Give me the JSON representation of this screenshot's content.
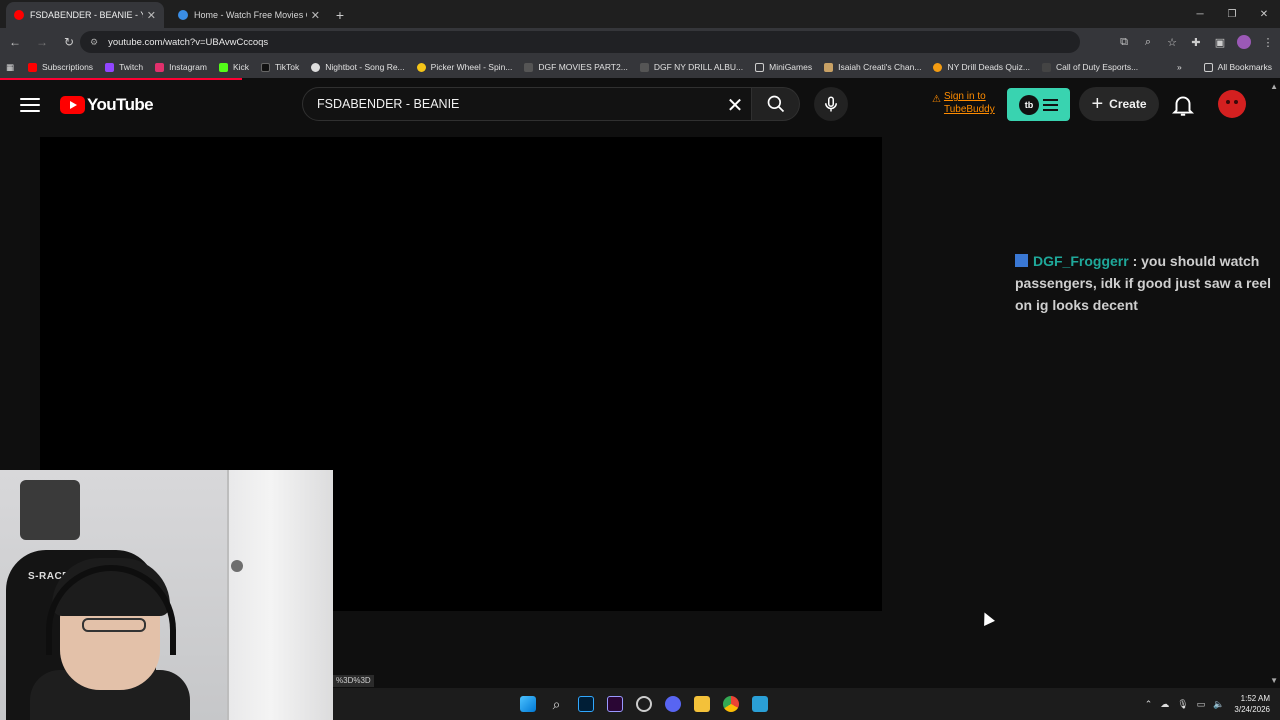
{
  "browser": {
    "tabs": [
      {
        "title": "FSDABENDER - BEANIE - YouTu",
        "active": true,
        "favicon_color": "#ff0000"
      },
      {
        "title": "Home - Watch Free Movies On",
        "active": false,
        "favicon_color": "#3a8ee6"
      }
    ],
    "url": "youtube.com/watch?v=UBAvwCccoqs",
    "bookmarks": [
      {
        "label": "Subscriptions",
        "icon_color": "#ff0000"
      },
      {
        "label": "Twitch",
        "icon_color": "#9146ff"
      },
      {
        "label": "Instagram",
        "icon_color": "#e1306c"
      },
      {
        "label": "Kick",
        "icon_color": "#53fc18"
      },
      {
        "label": "TikTok",
        "icon_color": "#111111"
      },
      {
        "label": "Nightbot - Song Re...",
        "icon_color": "#dddddd"
      },
      {
        "label": "Picker Wheel - Spin...",
        "icon_color": "#f5c518"
      },
      {
        "label": "DGF MOVIES PART2...",
        "icon_color": "#333333"
      },
      {
        "label": "DGF NY DRILL ALBU...",
        "icon_color": "#333333"
      },
      {
        "label": "MiniGames",
        "icon_color": "#888888"
      },
      {
        "label": "Isaiah Creati's Chan...",
        "icon_color": "#c8a165"
      },
      {
        "label": "NY Drill Deads Quiz...",
        "icon_color": "#f39c12"
      },
      {
        "label": "Call of Duty Esports...",
        "icon_color": "#444444"
      }
    ],
    "all_bookmarks": "All Bookmarks"
  },
  "youtube": {
    "logo_text": "YouTube",
    "search_value": "FSDABENDER - BEANIE",
    "tubebuddy_signin_line1": "Sign in to",
    "tubebuddy_signin_line2": "TubeBuddy",
    "tubebuddy_logo": "tb",
    "create_label": "Create"
  },
  "chat_overlay": {
    "username": "DGF_Froggerr",
    "message": " : you should watch passengers, idk if good just saw a reel on ig looks decent"
  },
  "webcam": {
    "chair_brand": "S-RACER"
  },
  "status_bar_url": "%3D%3D",
  "taskbar": {
    "apps": [
      "windows-start",
      "search",
      "photoshop",
      "premiere",
      "obs",
      "discord",
      "file-explorer",
      "chrome",
      "notepad"
    ],
    "time": "1:52 AM",
    "date": "3/24/2026"
  },
  "colors": {
    "yt_red": "#ff0000",
    "tubebuddy_green": "#39d3b0",
    "chat_user": "#1fa89a"
  }
}
